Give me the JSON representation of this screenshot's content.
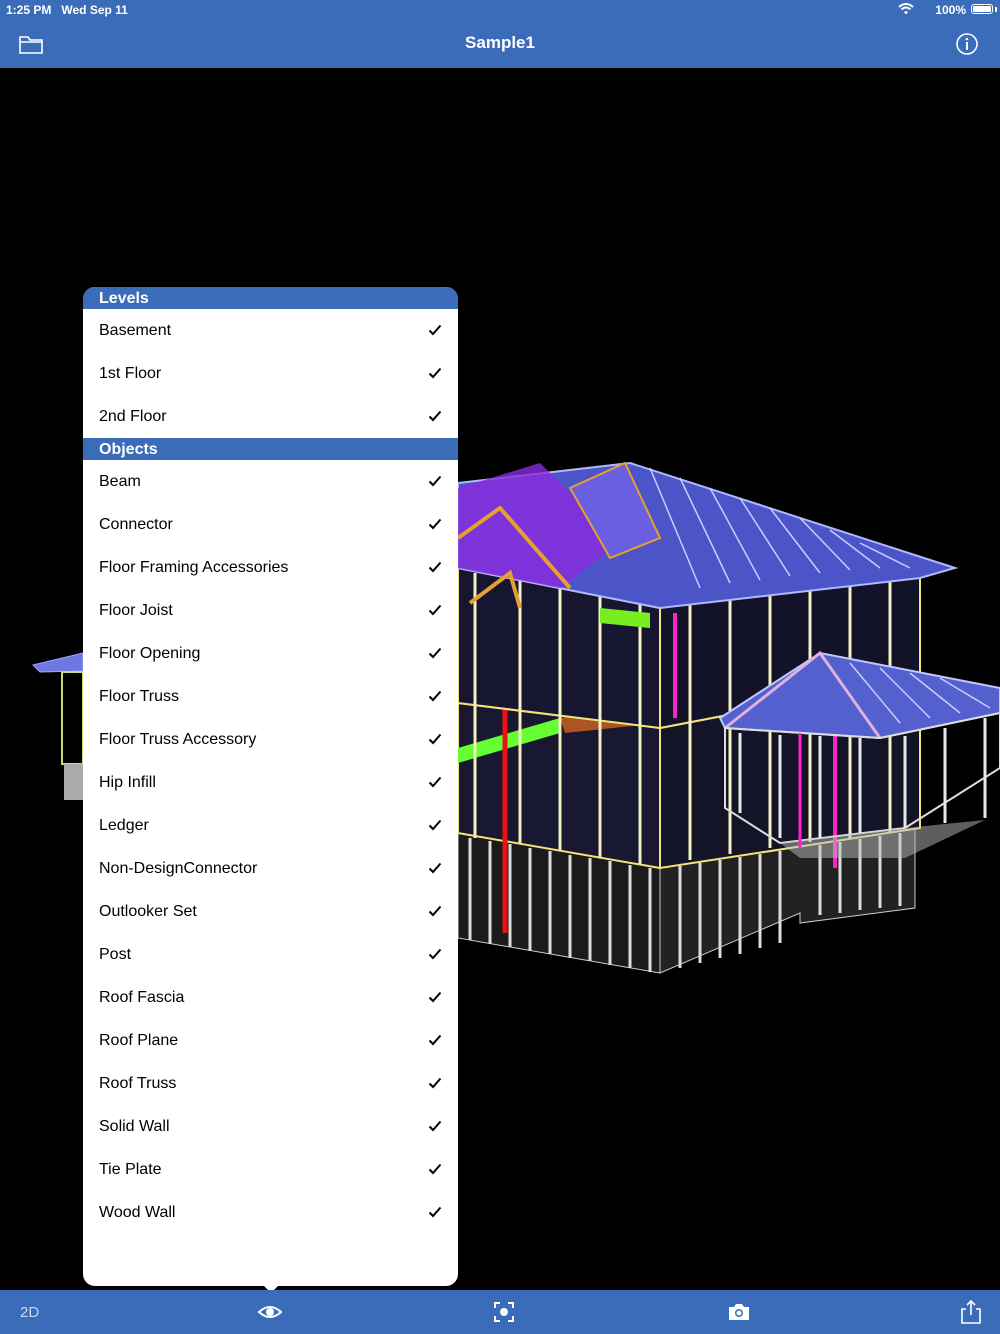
{
  "status_bar": {
    "time": "1:25 PM",
    "date": "Wed Sep 11",
    "battery": "100%"
  },
  "nav": {
    "title": "Sample1",
    "left_icon": "folder-icon",
    "right_icon": "info-icon"
  },
  "levels": {
    "header": "Levels",
    "items": [
      {
        "label": "Basement",
        "checked": true
      },
      {
        "label": "1st Floor",
        "checked": true
      },
      {
        "label": "2nd Floor",
        "checked": true
      }
    ]
  },
  "objects": {
    "header": "Objects",
    "items": [
      {
        "label": "Beam",
        "checked": true
      },
      {
        "label": "Connector",
        "checked": true
      },
      {
        "label": "Floor Framing Accessories",
        "checked": true
      },
      {
        "label": "Floor Joist",
        "checked": true
      },
      {
        "label": "Floor Opening",
        "checked": true
      },
      {
        "label": "Floor Truss",
        "checked": true
      },
      {
        "label": "Floor Truss Accessory",
        "checked": true
      },
      {
        "label": "Hip Infill",
        "checked": true
      },
      {
        "label": "Ledger",
        "checked": true
      },
      {
        "label": "Non-DesignConnector",
        "checked": true
      },
      {
        "label": "Outlooker Set",
        "checked": true
      },
      {
        "label": "Post",
        "checked": true
      },
      {
        "label": "Roof Fascia",
        "checked": true
      },
      {
        "label": "Roof Plane",
        "checked": true
      },
      {
        "label": "Roof Truss",
        "checked": true
      },
      {
        "label": "Solid Wall",
        "checked": true
      },
      {
        "label": "Tie Plate",
        "checked": true
      },
      {
        "label": "Wood Wall",
        "checked": true
      }
    ]
  },
  "toolbar": {
    "view_mode_label": "2D",
    "icons": [
      "eye-icon",
      "focus-icon",
      "camera-icon",
      "share-icon"
    ]
  },
  "colors": {
    "bar_blue": "#3b6cb9",
    "background": "#000000"
  }
}
